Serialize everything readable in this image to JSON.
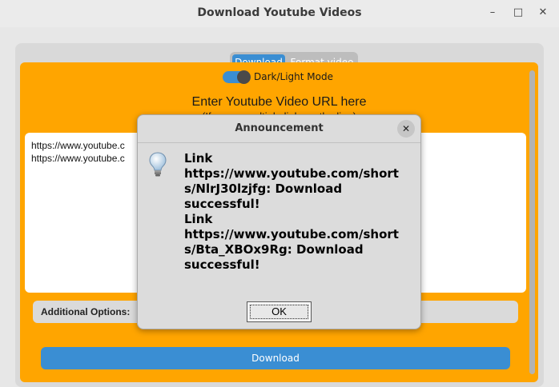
{
  "window": {
    "title": "Download Youtube Videos",
    "minimize": "–",
    "maximize": "□",
    "close": "✕"
  },
  "tabs": {
    "download": "Download",
    "format": "Format video",
    "active": "Download"
  },
  "theme_toggle": {
    "label": "Dark/Light Mode",
    "on": true
  },
  "url_section": {
    "label": "Enter Youtube Video URL here",
    "sublabel": "(If you ... multiple links ... the line)",
    "lines": [
      "https://www.youtube.c",
      "https://www.youtube.c"
    ]
  },
  "options": {
    "label": "Additional Options:"
  },
  "download_button": "Download",
  "dialog": {
    "title": "Announcement",
    "close": "✕",
    "message": "Link https://www.youtube.com/shorts/NlrJ30lzjfg: Download successful!\nLink https://www.youtube.com/shorts/Bta_XBOx9Rg: Download successful!",
    "message_lines": [
      "Link",
      "https://www.youtube.com/short",
      "s/NlrJ30lzjfg: Download",
      "successful!",
      "Link",
      "https://www.youtube.com/short",
      "s/Bta_XBOx9Rg: Download",
      "successful!"
    ],
    "ok": "OK",
    "icon": "lightbulb-icon"
  },
  "colors": {
    "accent": "#3a8ed3",
    "panel": "#ffa500",
    "dialog_bg": "#dcdcdc"
  }
}
